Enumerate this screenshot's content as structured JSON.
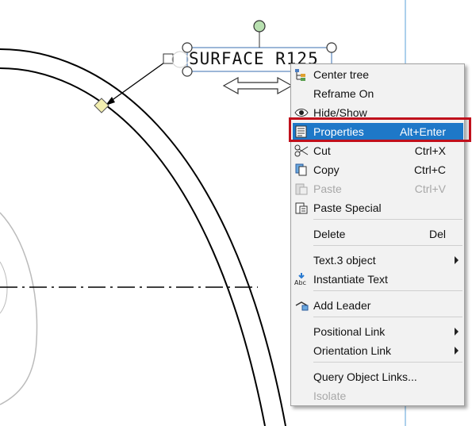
{
  "drawing": {
    "annotation_text": "SURFACE R125"
  },
  "context_menu": {
    "items": [
      {
        "label": "Center tree",
        "shortcut": "",
        "icon": "tree-icon"
      },
      {
        "label": "Reframe On",
        "shortcut": "",
        "icon": ""
      },
      {
        "label": "Hide/Show",
        "shortcut": "",
        "icon": "eye-icon"
      },
      {
        "label": "Properties",
        "shortcut": "Alt+Enter",
        "icon": "properties-icon"
      },
      {
        "label": "Cut",
        "shortcut": "Ctrl+X",
        "icon": "scissors-icon"
      },
      {
        "label": "Copy",
        "shortcut": "Ctrl+C",
        "icon": "copy-icon"
      },
      {
        "label": "Paste",
        "shortcut": "Ctrl+V",
        "icon": "paste-icon"
      },
      {
        "label": "Paste Special",
        "shortcut": "",
        "icon": "paste-special-icon"
      },
      {
        "label": "Delete",
        "shortcut": "Del",
        "icon": ""
      },
      {
        "label": "Text.3 object",
        "shortcut": "",
        "icon": "submenu-arrow-icon"
      },
      {
        "label": "Instantiate Text",
        "shortcut": "",
        "icon": "instantiate-text-icon"
      },
      {
        "label": "Add Leader",
        "shortcut": "",
        "icon": "add-leader-icon"
      },
      {
        "label": "Positional Link",
        "shortcut": "",
        "icon": "submenu-arrow-icon"
      },
      {
        "label": "Orientation Link",
        "shortcut": "",
        "icon": "submenu-arrow-icon"
      },
      {
        "label": "Query Object Links...",
        "shortcut": "",
        "icon": ""
      },
      {
        "label": "Isolate",
        "shortcut": "",
        "icon": ""
      }
    ],
    "highlighted": "Properties",
    "disabled": [
      "Paste",
      "Isolate"
    ]
  },
  "colors": {
    "highlight": "#1e78c8",
    "callout_border": "#c0101c",
    "handle_green": "#b8e0b0",
    "anchor_yellow": "#f3efb0"
  }
}
